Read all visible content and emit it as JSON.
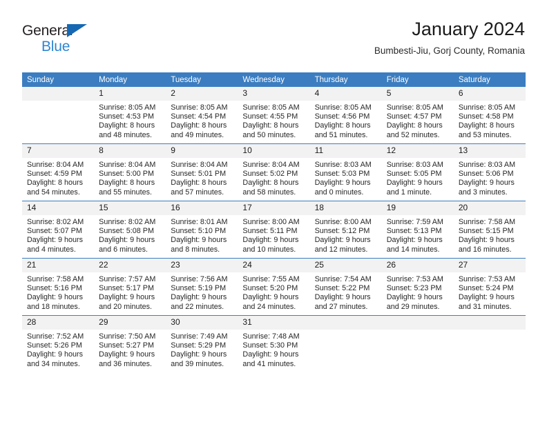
{
  "brand": {
    "name_top": "General",
    "name_bottom": "Blue",
    "triangle_color": "#1668b3",
    "text_color_top": "#231f20",
    "text_color_bottom": "#2e86d4"
  },
  "header": {
    "title": "January 2024",
    "subtitle": "Bumbesti-Jiu, Gorj County, Romania"
  },
  "theme": {
    "header_blue": "#3b7dc0",
    "date_band_gray": "#f2f2f2",
    "text_color": "#262626"
  },
  "weekday_headers": [
    "Sunday",
    "Monday",
    "Tuesday",
    "Wednesday",
    "Thursday",
    "Friday",
    "Saturday"
  ],
  "weeks": [
    [
      {
        "day": "",
        "blank": true,
        "sunrise": "",
        "sunset": "",
        "daylight_line1": "",
        "daylight_line2": ""
      },
      {
        "day": "1",
        "sunrise": "Sunrise: 8:05 AM",
        "sunset": "Sunset: 4:53 PM",
        "daylight_line1": "Daylight: 8 hours",
        "daylight_line2": "and 48 minutes."
      },
      {
        "day": "2",
        "sunrise": "Sunrise: 8:05 AM",
        "sunset": "Sunset: 4:54 PM",
        "daylight_line1": "Daylight: 8 hours",
        "daylight_line2": "and 49 minutes."
      },
      {
        "day": "3",
        "sunrise": "Sunrise: 8:05 AM",
        "sunset": "Sunset: 4:55 PM",
        "daylight_line1": "Daylight: 8 hours",
        "daylight_line2": "and 50 minutes."
      },
      {
        "day": "4",
        "sunrise": "Sunrise: 8:05 AM",
        "sunset": "Sunset: 4:56 PM",
        "daylight_line1": "Daylight: 8 hours",
        "daylight_line2": "and 51 minutes."
      },
      {
        "day": "5",
        "sunrise": "Sunrise: 8:05 AM",
        "sunset": "Sunset: 4:57 PM",
        "daylight_line1": "Daylight: 8 hours",
        "daylight_line2": "and 52 minutes."
      },
      {
        "day": "6",
        "sunrise": "Sunrise: 8:05 AM",
        "sunset": "Sunset: 4:58 PM",
        "daylight_line1": "Daylight: 8 hours",
        "daylight_line2": "and 53 minutes."
      }
    ],
    [
      {
        "day": "7",
        "sunrise": "Sunrise: 8:04 AM",
        "sunset": "Sunset: 4:59 PM",
        "daylight_line1": "Daylight: 8 hours",
        "daylight_line2": "and 54 minutes."
      },
      {
        "day": "8",
        "sunrise": "Sunrise: 8:04 AM",
        "sunset": "Sunset: 5:00 PM",
        "daylight_line1": "Daylight: 8 hours",
        "daylight_line2": "and 55 minutes."
      },
      {
        "day": "9",
        "sunrise": "Sunrise: 8:04 AM",
        "sunset": "Sunset: 5:01 PM",
        "daylight_line1": "Daylight: 8 hours",
        "daylight_line2": "and 57 minutes."
      },
      {
        "day": "10",
        "sunrise": "Sunrise: 8:04 AM",
        "sunset": "Sunset: 5:02 PM",
        "daylight_line1": "Daylight: 8 hours",
        "daylight_line2": "and 58 minutes."
      },
      {
        "day": "11",
        "sunrise": "Sunrise: 8:03 AM",
        "sunset": "Sunset: 5:03 PM",
        "daylight_line1": "Daylight: 9 hours",
        "daylight_line2": "and 0 minutes."
      },
      {
        "day": "12",
        "sunrise": "Sunrise: 8:03 AM",
        "sunset": "Sunset: 5:05 PM",
        "daylight_line1": "Daylight: 9 hours",
        "daylight_line2": "and 1 minute."
      },
      {
        "day": "13",
        "sunrise": "Sunrise: 8:03 AM",
        "sunset": "Sunset: 5:06 PM",
        "daylight_line1": "Daylight: 9 hours",
        "daylight_line2": "and 3 minutes."
      }
    ],
    [
      {
        "day": "14",
        "sunrise": "Sunrise: 8:02 AM",
        "sunset": "Sunset: 5:07 PM",
        "daylight_line1": "Daylight: 9 hours",
        "daylight_line2": "and 4 minutes."
      },
      {
        "day": "15",
        "sunrise": "Sunrise: 8:02 AM",
        "sunset": "Sunset: 5:08 PM",
        "daylight_line1": "Daylight: 9 hours",
        "daylight_line2": "and 6 minutes."
      },
      {
        "day": "16",
        "sunrise": "Sunrise: 8:01 AM",
        "sunset": "Sunset: 5:10 PM",
        "daylight_line1": "Daylight: 9 hours",
        "daylight_line2": "and 8 minutes."
      },
      {
        "day": "17",
        "sunrise": "Sunrise: 8:00 AM",
        "sunset": "Sunset: 5:11 PM",
        "daylight_line1": "Daylight: 9 hours",
        "daylight_line2": "and 10 minutes."
      },
      {
        "day": "18",
        "sunrise": "Sunrise: 8:00 AM",
        "sunset": "Sunset: 5:12 PM",
        "daylight_line1": "Daylight: 9 hours",
        "daylight_line2": "and 12 minutes."
      },
      {
        "day": "19",
        "sunrise": "Sunrise: 7:59 AM",
        "sunset": "Sunset: 5:13 PM",
        "daylight_line1": "Daylight: 9 hours",
        "daylight_line2": "and 14 minutes."
      },
      {
        "day": "20",
        "sunrise": "Sunrise: 7:58 AM",
        "sunset": "Sunset: 5:15 PM",
        "daylight_line1": "Daylight: 9 hours",
        "daylight_line2": "and 16 minutes."
      }
    ],
    [
      {
        "day": "21",
        "sunrise": "Sunrise: 7:58 AM",
        "sunset": "Sunset: 5:16 PM",
        "daylight_line1": "Daylight: 9 hours",
        "daylight_line2": "and 18 minutes."
      },
      {
        "day": "22",
        "sunrise": "Sunrise: 7:57 AM",
        "sunset": "Sunset: 5:17 PM",
        "daylight_line1": "Daylight: 9 hours",
        "daylight_line2": "and 20 minutes."
      },
      {
        "day": "23",
        "sunrise": "Sunrise: 7:56 AM",
        "sunset": "Sunset: 5:19 PM",
        "daylight_line1": "Daylight: 9 hours",
        "daylight_line2": "and 22 minutes."
      },
      {
        "day": "24",
        "sunrise": "Sunrise: 7:55 AM",
        "sunset": "Sunset: 5:20 PM",
        "daylight_line1": "Daylight: 9 hours",
        "daylight_line2": "and 24 minutes."
      },
      {
        "day": "25",
        "sunrise": "Sunrise: 7:54 AM",
        "sunset": "Sunset: 5:22 PM",
        "daylight_line1": "Daylight: 9 hours",
        "daylight_line2": "and 27 minutes."
      },
      {
        "day": "26",
        "sunrise": "Sunrise: 7:53 AM",
        "sunset": "Sunset: 5:23 PM",
        "daylight_line1": "Daylight: 9 hours",
        "daylight_line2": "and 29 minutes."
      },
      {
        "day": "27",
        "sunrise": "Sunrise: 7:53 AM",
        "sunset": "Sunset: 5:24 PM",
        "daylight_line1": "Daylight: 9 hours",
        "daylight_line2": "and 31 minutes."
      }
    ],
    [
      {
        "day": "28",
        "sunrise": "Sunrise: 7:52 AM",
        "sunset": "Sunset: 5:26 PM",
        "daylight_line1": "Daylight: 9 hours",
        "daylight_line2": "and 34 minutes."
      },
      {
        "day": "29",
        "sunrise": "Sunrise: 7:50 AM",
        "sunset": "Sunset: 5:27 PM",
        "daylight_line1": "Daylight: 9 hours",
        "daylight_line2": "and 36 minutes."
      },
      {
        "day": "30",
        "sunrise": "Sunrise: 7:49 AM",
        "sunset": "Sunset: 5:29 PM",
        "daylight_line1": "Daylight: 9 hours",
        "daylight_line2": "and 39 minutes."
      },
      {
        "day": "31",
        "sunrise": "Sunrise: 7:48 AM",
        "sunset": "Sunset: 5:30 PM",
        "daylight_line1": "Daylight: 9 hours",
        "daylight_line2": "and 41 minutes."
      },
      {
        "day": "",
        "blank": true,
        "sunrise": "",
        "sunset": "",
        "daylight_line1": "",
        "daylight_line2": ""
      },
      {
        "day": "",
        "blank": true,
        "sunrise": "",
        "sunset": "",
        "daylight_line1": "",
        "daylight_line2": ""
      },
      {
        "day": "",
        "blank": true,
        "sunrise": "",
        "sunset": "",
        "daylight_line1": "",
        "daylight_line2": ""
      }
    ]
  ]
}
